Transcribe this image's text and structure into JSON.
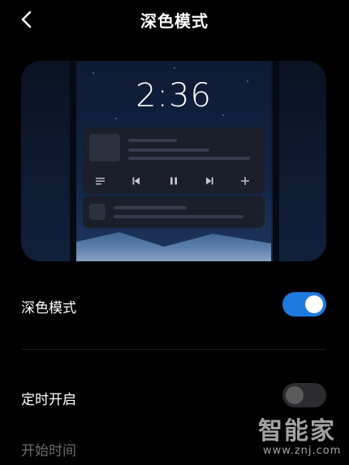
{
  "header": {
    "title": "深色模式"
  },
  "preview": {
    "lock_time": "2:36",
    "controls": [
      "list-icon",
      "previous-icon",
      "pause-icon",
      "next-icon",
      "plus-icon"
    ]
  },
  "settings": {
    "dark_mode": {
      "label": "深色模式",
      "enabled": true
    },
    "scheduled": {
      "label": "定时开启",
      "enabled": false
    },
    "start_time": {
      "label": "开始时间"
    }
  },
  "watermark": {
    "brand": "智能家",
    "url": "www.znj.com"
  },
  "colors": {
    "background": "#000000",
    "accent": "#1f7ae0",
    "disabled_text": "#6d6d6d"
  }
}
